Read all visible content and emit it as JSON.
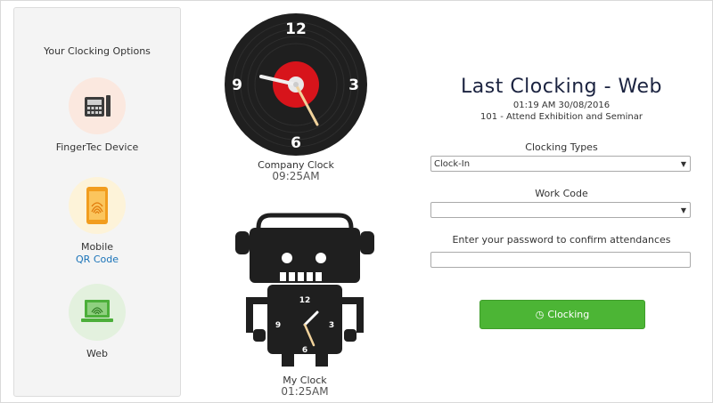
{
  "options_panel": {
    "title": "Your Clocking Options",
    "items": [
      {
        "label": "FingerTec Device",
        "icon": "fingerprint-terminal-icon"
      },
      {
        "label": "Mobile",
        "sub_label": "QR Code",
        "icon": "mobile-fingerprint-icon"
      },
      {
        "label": "Web",
        "icon": "laptop-fingerprint-icon"
      }
    ]
  },
  "company_clock": {
    "numbers": [
      "12",
      "3",
      "6",
      "9"
    ],
    "caption": "Company Clock",
    "time": "09:25AM"
  },
  "my_clock": {
    "numbers": [
      "12",
      "3",
      "6",
      "9"
    ],
    "caption": "My Clock",
    "time": "01:25AM"
  },
  "last_clocking": {
    "title": "Last Clocking - Web",
    "datetime": "01:19 AM 30/08/2016",
    "event": "101 - Attend Exhibition and Seminar"
  },
  "form": {
    "clocking_types_label": "Clocking Types",
    "clocking_type_value": "Clock-In",
    "work_code_label": "Work Code",
    "work_code_value": "",
    "password_label": "Enter your password to confirm attendances",
    "password_value": "",
    "submit_label": "Clocking"
  },
  "colors": {
    "accent_green": "#4cb535",
    "record_red": "#d7141b",
    "title_navy": "#1b2340",
    "link_blue": "#1a73b8"
  }
}
